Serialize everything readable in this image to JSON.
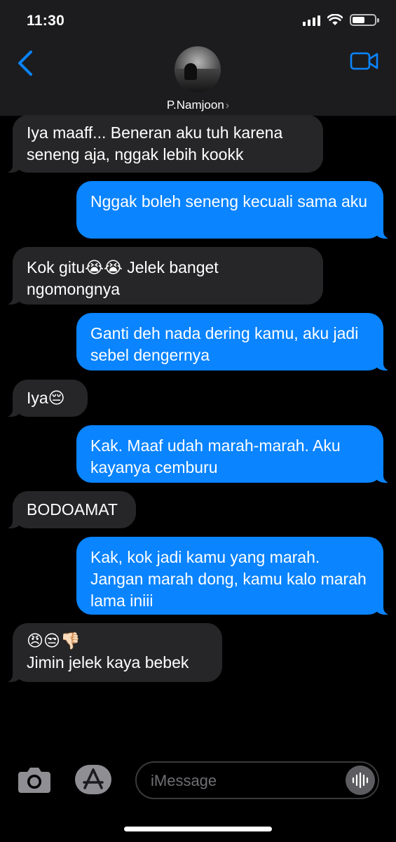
{
  "status_bar": {
    "time": "11:30"
  },
  "header": {
    "contact_name": "P.Namjoon",
    "chevron": "›"
  },
  "messages": [
    {
      "side": "in",
      "text": "Iya maaff... Beneran aku tuh karena seneng aja, nggak lebih kookk"
    },
    {
      "side": "out",
      "text": "Nggak boleh seneng kecuali sama aku"
    },
    {
      "side": "in",
      "text": "Kok gitu😭😭 Jelek banget ngomongnya"
    },
    {
      "side": "out",
      "text": "Ganti deh nada dering kamu, aku jadi sebel dengernya"
    },
    {
      "side": "in",
      "text": "Iya😔"
    },
    {
      "side": "out",
      "text": "Kak. Maaf udah marah-marah. Aku kayanya cemburu"
    },
    {
      "side": "in",
      "text": "BODOAMAT"
    },
    {
      "side": "out",
      "text": "Kak, kok jadi kamu yang marah. Jangan marah dong, kamu kalo marah lama iniii"
    },
    {
      "side": "in",
      "text": "😠😒👎🏻\nJimin jelek kaya bebek"
    }
  ],
  "composer": {
    "placeholder": "iMessage"
  },
  "icons": {
    "back": "chevron-left-icon",
    "video": "video-camera-icon",
    "camera": "camera-icon",
    "apps": "app-store-icon",
    "audio": "audio-waveform-icon"
  },
  "colors": {
    "accent": "#0a84ff",
    "incoming_bubble": "#262628",
    "header_bg": "#1c1c1e",
    "background": "#000000"
  }
}
